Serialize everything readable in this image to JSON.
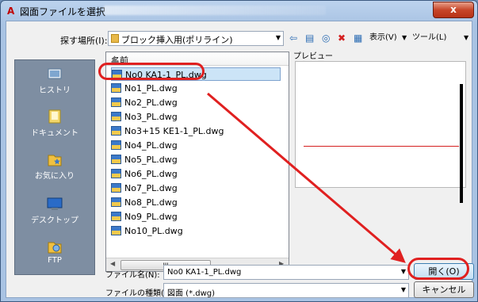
{
  "window": {
    "title": "図面ファイルを選択",
    "app_icon": "A",
    "close_glyph": "x"
  },
  "toolbar": {
    "look_in_label": "探す場所(I):",
    "look_in_value": "ブロック挿入用(ポリライン)",
    "view_menu": "表示(V)",
    "tools_menu": "ツール(L)"
  },
  "places": [
    {
      "label": "ヒストリ",
      "icon": "history-icon"
    },
    {
      "label": "ドキュメント",
      "icon": "documents-icon"
    },
    {
      "label": "お気に入り",
      "icon": "favorites-icon"
    },
    {
      "label": "デスクトップ",
      "icon": "desktop-icon"
    },
    {
      "label": "FTP",
      "icon": "ftp-icon"
    }
  ],
  "file_list": {
    "header": "名前",
    "files": [
      "No0 KA1-1_PL.dwg",
      "No1_PL.dwg",
      "No2_PL.dwg",
      "No3_PL.dwg",
      "No3+15 KE1-1_PL.dwg",
      "No4_PL.dwg",
      "No5_PL.dwg",
      "No6_PL.dwg",
      "No7_PL.dwg",
      "No8_PL.dwg",
      "No9_PL.dwg",
      "No10_PL.dwg"
    ],
    "selected_index": 0,
    "scroll_thumb": "ııı"
  },
  "preview": {
    "label": "プレビュー"
  },
  "footer": {
    "filename_label": "ファイル名(N):",
    "filename_value": "No0 KA1-1_PL.dwg",
    "filetype_label": "ファイルの種類(T):",
    "filetype_value": "図面 (*.dwg)",
    "open_button": "開く(O)",
    "cancel_button": "キャンセル"
  },
  "colors": {
    "highlight": "#e02020",
    "selection": "#cce4f7"
  }
}
